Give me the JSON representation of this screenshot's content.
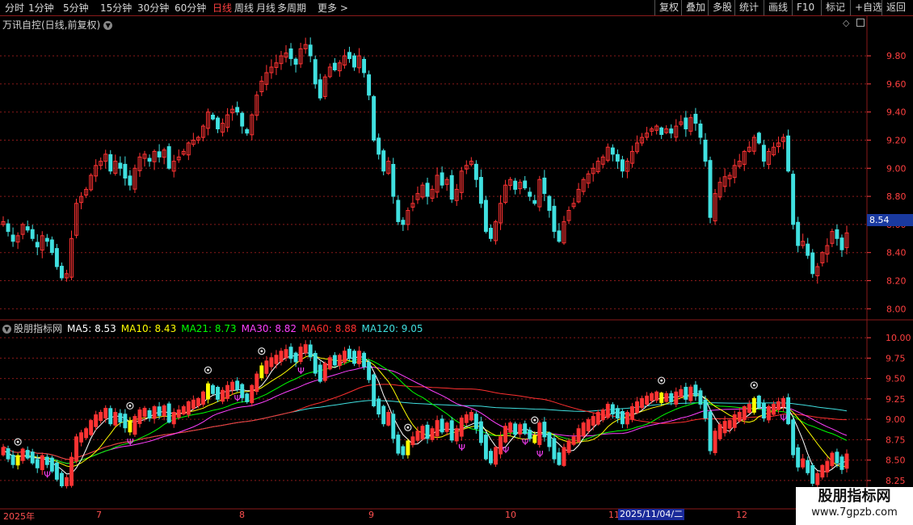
{
  "toolbar": {
    "periods": [
      "分时",
      "1分钟",
      "5分钟",
      "15分钟",
      "30分钟",
      "60分钟",
      "日线",
      "周线",
      "月线",
      "多周期",
      "更多 >"
    ],
    "active_period": "日线",
    "right_buttons": [
      "复权",
      "叠加",
      "多股",
      "统计",
      "画线",
      "F10",
      "标记",
      "+自选",
      "返回"
    ]
  },
  "main_chart": {
    "title": "万讯自控(日线,前复权)",
    "price_tag": "8.54",
    "y_ticks": [
      "9.80",
      "9.60",
      "9.40",
      "9.20",
      "9.00",
      "8.80",
      "8.60",
      "8.40",
      "8.20",
      "8.00"
    ]
  },
  "indicator": {
    "name": "股朋指标网",
    "ma": [
      {
        "label": "MA5: 8.53",
        "color": "#ffffff"
      },
      {
        "label": "MA10: 8.43",
        "color": "#ffff00"
      },
      {
        "label": "MA21: 8.73",
        "color": "#00ff00"
      },
      {
        "label": "MA30: 8.82",
        "color": "#ff40ff"
      },
      {
        "label": "MA60: 8.88",
        "color": "#ff3030"
      },
      {
        "label": "MA120: 9.05",
        "color": "#40e0e0"
      }
    ],
    "y_ticks": [
      "10.00",
      "9.75",
      "9.50",
      "9.25",
      "9.00",
      "8.75",
      "8.50",
      "8.25"
    ]
  },
  "date_axis": {
    "labels": [
      "2025年",
      "7",
      "8",
      "9",
      "10",
      "11",
      "12"
    ],
    "selected": "2025/11/04/二"
  },
  "watermark": {
    "line1": "股朋指标网",
    "line2": "www.7gpzb.com"
  },
  "colors": {
    "up": "#ff3333",
    "down": "#40e0e0",
    "grid": "#8a1a1a",
    "signal": "#ffff00",
    "ma5": "#ffffff",
    "ma10": "#ffff00",
    "ma21": "#00ff00",
    "ma30": "#ff40ff",
    "ma60": "#ff3030",
    "ma120": "#40e0e0"
  },
  "chart_data": {
    "type": "candlestick",
    "ylim_main": [
      7.95,
      9.95
    ],
    "ylim_indicator": [
      8.15,
      10.1
    ],
    "close": [
      8.62,
      8.55,
      8.48,
      8.52,
      8.6,
      8.56,
      8.5,
      8.44,
      8.52,
      8.48,
      8.4,
      8.3,
      8.22,
      8.25,
      8.5,
      8.75,
      8.8,
      8.85,
      8.95,
      9.02,
      9.05,
      9.1,
      8.98,
      9.05,
      9.0,
      8.93,
      8.88,
      9.0,
      9.08,
      9.1,
      9.05,
      9.12,
      9.08,
      9.13,
      9.0,
      9.05,
      9.08,
      9.12,
      9.18,
      9.2,
      9.22,
      9.3,
      9.4,
      9.35,
      9.28,
      9.32,
      9.38,
      9.42,
      9.4,
      9.3,
      9.25,
      9.38,
      9.52,
      9.62,
      9.68,
      9.72,
      9.75,
      9.8,
      9.82,
      9.78,
      9.74,
      9.85,
      9.88,
      9.8,
      9.6,
      9.5,
      9.65,
      9.72,
      9.7,
      9.75,
      9.8,
      9.78,
      9.72,
      9.8,
      9.68,
      9.52,
      9.2,
      9.1,
      8.98,
      9.05,
      8.8,
      8.62,
      8.6,
      8.7,
      8.75,
      8.82,
      8.88,
      8.8,
      8.85,
      8.95,
      8.88,
      8.92,
      8.78,
      8.85,
      8.98,
      9.02,
      9.05,
      8.92,
      8.75,
      8.55,
      8.5,
      8.62,
      8.75,
      8.88,
      8.92,
      8.85,
      8.9,
      8.86,
      8.8,
      8.75,
      8.92,
      8.82,
      8.7,
      8.55,
      8.48,
      8.62,
      8.7,
      8.75,
      8.85,
      8.92,
      8.96,
      9.0,
      9.05,
      9.08,
      9.15,
      9.1,
      9.05,
      8.98,
      9.05,
      9.12,
      9.18,
      9.22,
      9.25,
      9.28,
      9.3,
      9.24,
      9.28,
      9.25,
      9.3,
      9.33,
      9.28,
      9.36,
      9.32,
      9.22,
      9.05,
      8.65,
      8.82,
      8.9,
      8.94,
      8.95,
      9.02,
      9.05,
      9.12,
      9.15,
      9.22,
      9.18,
      9.05,
      9.12,
      9.15,
      9.18,
      9.22,
      8.98,
      8.6,
      8.45,
      8.48,
      8.38,
      8.25,
      8.3,
      8.4,
      8.45,
      8.55,
      8.5,
      8.42,
      8.54
    ],
    "signals_circle": [
      3,
      26,
      42,
      53,
      83,
      109,
      135,
      154
    ],
    "signals_psi": [
      9,
      26,
      48,
      61,
      94,
      103,
      107,
      110,
      160
    ]
  }
}
